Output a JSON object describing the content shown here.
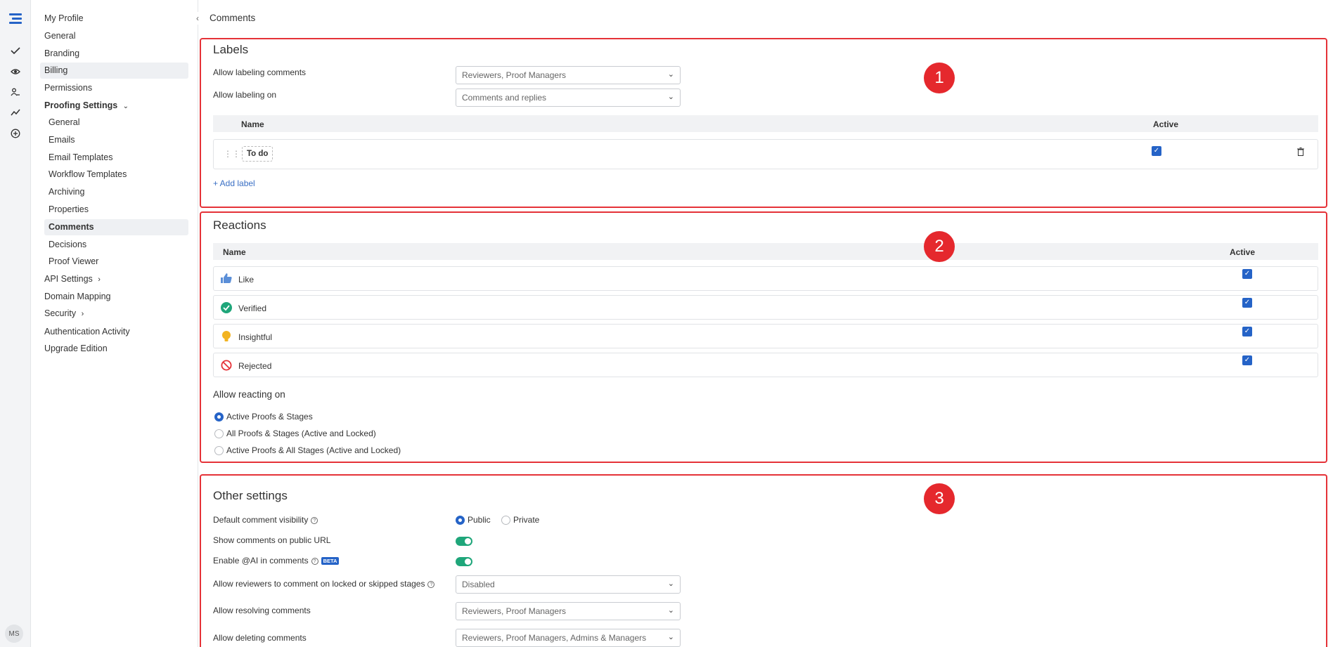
{
  "rail": {
    "icons": [
      "menu-logo-icon",
      "check-icon",
      "eye-icon",
      "users-icon",
      "trend-icon",
      "plus-circle-icon"
    ],
    "avatar": "MS"
  },
  "sidebar": {
    "items": [
      {
        "label": "My Profile"
      },
      {
        "label": "General"
      },
      {
        "label": "Branding"
      },
      {
        "label": "Billing"
      },
      {
        "label": "Permissions"
      },
      {
        "label": "Proofing Settings"
      },
      {
        "label": "General"
      },
      {
        "label": "Emails"
      },
      {
        "label": "Email Templates"
      },
      {
        "label": "Workflow Templates"
      },
      {
        "label": "Archiving"
      },
      {
        "label": "Properties"
      },
      {
        "label": "Comments"
      },
      {
        "label": "Decisions"
      },
      {
        "label": "Proof Viewer"
      },
      {
        "label": "API Settings"
      },
      {
        "label": "Domain Mapping"
      },
      {
        "label": "Security"
      },
      {
        "label": "Authentication Activity"
      },
      {
        "label": "Upgrade Edition"
      }
    ]
  },
  "page": {
    "title": "Comments"
  },
  "labels": {
    "title": "Labels",
    "allow_labeling_comments": {
      "label": "Allow labeling comments",
      "value": "Reviewers, Proof Managers"
    },
    "allow_labeling_on": {
      "label": "Allow labeling on",
      "value": "Comments and replies"
    },
    "columns": {
      "name": "Name",
      "active": "Active"
    },
    "rows": [
      {
        "name": "To do",
        "active": true
      }
    ],
    "add_label": "+ Add label"
  },
  "reactions": {
    "title": "Reactions",
    "columns": {
      "name": "Name",
      "active": "Active"
    },
    "rows": [
      {
        "name": "Like",
        "icon": "thumbs-up-icon",
        "active": true
      },
      {
        "name": "Verified",
        "icon": "verified-check-icon",
        "active": true
      },
      {
        "name": "Insightful",
        "icon": "lightbulb-icon",
        "active": true
      },
      {
        "name": "Rejected",
        "icon": "rejected-icon",
        "active": true
      }
    ],
    "allow_reacting_on": "Allow reacting on",
    "options": [
      "Active Proofs & Stages",
      "All Proofs & Stages (Active and Locked)",
      "Active Proofs & All Stages (Active and Locked)"
    ],
    "selected": 0
  },
  "other": {
    "title": "Other settings",
    "default_visibility": {
      "label": "Default comment visibility",
      "options": [
        "Public",
        "Private"
      ],
      "selected": "Public"
    },
    "show_public": {
      "label": "Show comments on public URL",
      "on": true
    },
    "enable_ai": {
      "label": "Enable @AI in comments",
      "badge": "BETA",
      "on": true
    },
    "locked_stages": {
      "label": "Allow reviewers to comment on locked or skipped stages",
      "value": "Disabled"
    },
    "resolving": {
      "label": "Allow resolving comments",
      "value": "Reviewers, Proof Managers"
    },
    "deleting": {
      "label": "Allow deleting comments",
      "value": "Reviewers, Proof Managers, Admins & Managers"
    }
  },
  "badges": [
    "1",
    "2",
    "3"
  ],
  "colors": {
    "accent": "#2563c7",
    "highlight": "#e53238",
    "toggle": "#1fa67a"
  }
}
